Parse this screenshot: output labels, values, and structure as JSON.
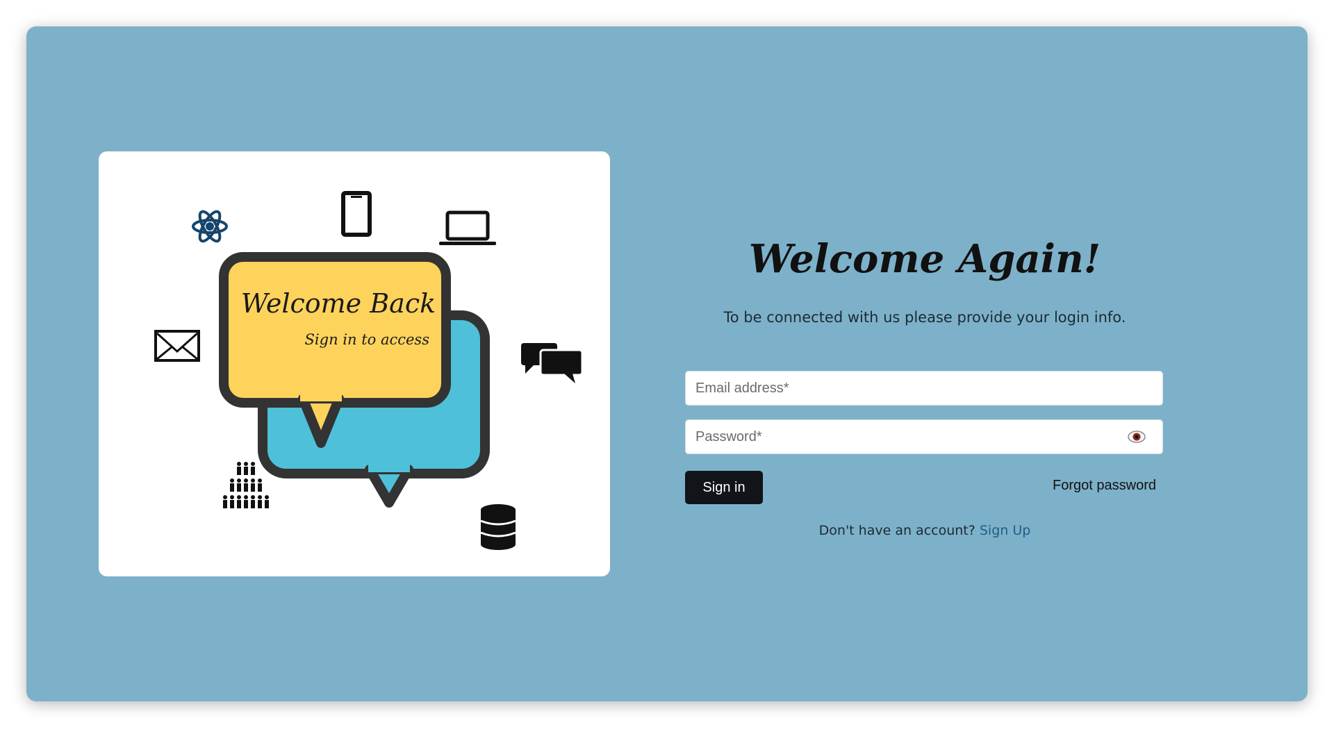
{
  "illustration": {
    "bubble_title": "Welcome Back",
    "bubble_subtitle": "Sign in to access"
  },
  "login": {
    "title": "Welcome Again!",
    "subtitle": "To be connected with us please provide your login info.",
    "email_placeholder": "Email address*",
    "password_placeholder": "Password*",
    "signin_label": "Sign in",
    "forgot_label": "Forgot password",
    "signup_prompt": "Don't have an account?",
    "signup_link": "Sign Up"
  },
  "colors": {
    "panel_background": "#7db1c9",
    "button_background": "#111418",
    "link": "#1f5f86",
    "bubble_yellow": "#fdd35c",
    "bubble_blue": "#4ec0d9"
  },
  "icons": [
    "atom-icon",
    "smartphone-icon",
    "laptop-icon",
    "envelope-icon",
    "chat-bubbles-icon",
    "people-group-icon",
    "database-icon",
    "eye-icon"
  ]
}
